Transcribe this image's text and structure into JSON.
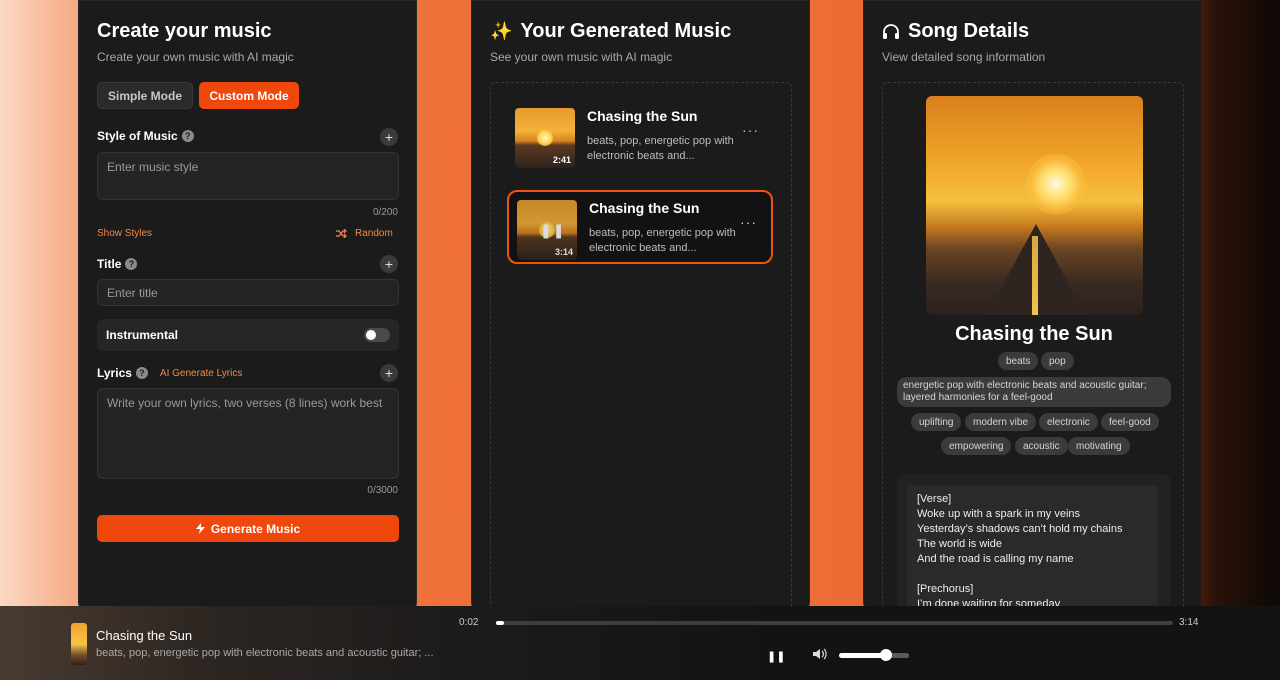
{
  "create": {
    "title": "Create your music",
    "subtitle": "Create your own music with AI magic",
    "simple_mode": "Simple Mode",
    "custom_mode": "Custom Mode",
    "style_label": "Style of Music",
    "style_placeholder": "Enter music style",
    "style_counter": "0/200",
    "show_styles": "Show Styles",
    "random": "Random",
    "title_label": "Title",
    "title_placeholder": "Enter title",
    "instrumental_label": "Instrumental",
    "lyrics_label": "Lyrics",
    "ai_generate_lyrics": "AI Generate Lyrics",
    "lyrics_placeholder": "Write your own lyrics, two verses (8 lines) work best",
    "lyrics_counter": "0/3000",
    "generate_button": "Generate Music",
    "help_glyph": "?"
  },
  "generated": {
    "title": "Your Generated Music",
    "subtitle": "See your own music with AI magic",
    "songs": [
      {
        "title": "Chasing the Sun",
        "desc": "beats, pop, energetic pop with electronic beats and...",
        "duration": "2:41"
      },
      {
        "title": "Chasing the Sun",
        "desc": "beats, pop, energetic pop with electronic beats and...",
        "duration": "3:14"
      }
    ],
    "more_glyph": "···"
  },
  "details": {
    "title": "Song Details",
    "subtitle": "View detailed song information",
    "song_title": "Chasing the Sun",
    "tags_top": [
      "beats",
      "pop"
    ],
    "style_description": "energetic pop with electronic beats and acoustic guitar; layered harmonies for a feel-good",
    "tags_bottom": [
      "uplifting",
      "modern vibe",
      "electronic",
      "feel-good",
      "empowering",
      "acoustic",
      "motivating"
    ],
    "lyrics": "[Verse]\nWoke up with a spark in my veins\nYesterday’s shadows can’t hold my chains\nThe world is wide\nAnd the road is calling my name\n\n[Prechorus]\nI’m done waiting for someday"
  },
  "player": {
    "title": "Chasing the Sun",
    "desc": "beats, pop, energetic pop with electronic beats and acoustic guitar; ...",
    "current_time": "0:02",
    "total_time": "3:14",
    "progress_fraction": 0.012,
    "volume_fraction": 0.67
  },
  "colors": {
    "accent": "#f0470d",
    "panel_bg": "#1b1b1b"
  },
  "icons": {
    "sparkles": "sparkles-icon",
    "headphones": "headphones-icon",
    "lightning": "lightning-icon",
    "shuffle": "shuffle-icon",
    "pause": "pause-icon",
    "volume": "volume-icon"
  }
}
